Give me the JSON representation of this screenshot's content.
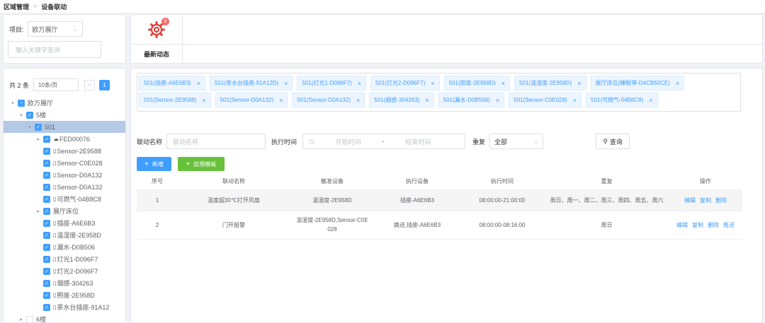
{
  "breadcrumb": {
    "root": "区域管理",
    "separator": ">",
    "current": "设备联动"
  },
  "project": {
    "label": "项目:",
    "selected": "欧万展厅",
    "search_placeholder": "输入关键字查询"
  },
  "dynamics": {
    "badge_count": "0",
    "label": "最新动态"
  },
  "tree_panel": {
    "total": "共 2 条",
    "page_size": "10条/页",
    "current_page": "1",
    "nodes": [
      {
        "label": "欧万展厅",
        "icon": "",
        "level": 0,
        "caret": "▾",
        "check": "indet",
        "selected": false
      },
      {
        "label": "5楼",
        "icon": "",
        "level": 1,
        "caret": "▾",
        "check": "checked",
        "selected": false
      },
      {
        "label": "501",
        "icon": "",
        "level": 2,
        "caret": "▾",
        "check": "checked",
        "selected": true
      },
      {
        "label": "FED00076",
        "icon": "☁",
        "level": 3,
        "caret": "▸",
        "check": "checked",
        "selected": false
      },
      {
        "label": "Sensor-2E9588",
        "icon": "▯",
        "level": 3,
        "caret": "",
        "check": "checked",
        "selected": false
      },
      {
        "label": "Sensor-C0E028",
        "icon": "▯",
        "level": 3,
        "caret": "",
        "check": "checked",
        "selected": false
      },
      {
        "label": "Sensor-D0A132",
        "icon": "▯",
        "level": 3,
        "caret": "",
        "check": "checked",
        "selected": false
      },
      {
        "label": "Sensor-D0A132",
        "icon": "▯",
        "level": 3,
        "caret": "",
        "check": "checked",
        "selected": false
      },
      {
        "label": "可燃气-04B8C8",
        "icon": "▯",
        "level": 3,
        "caret": "",
        "check": "checked",
        "selected": false
      },
      {
        "label": "展厅床位",
        "icon": "",
        "level": 3,
        "caret": "▸",
        "check": "checked",
        "selected": false
      },
      {
        "label": "插座-A6E6B3",
        "icon": "▯",
        "level": 3,
        "caret": "",
        "check": "checked",
        "selected": false
      },
      {
        "label": "温湿度-2E958D",
        "icon": "▯",
        "level": 3,
        "caret": "",
        "check": "checked",
        "selected": false
      },
      {
        "label": "漏水-D0B506",
        "icon": "▯",
        "level": 3,
        "caret": "",
        "check": "checked",
        "selected": false
      },
      {
        "label": "灯光1-D096F7",
        "icon": "▯",
        "level": 3,
        "caret": "",
        "check": "checked",
        "selected": false
      },
      {
        "label": "灯光2-D096F7",
        "icon": "▯",
        "level": 3,
        "caret": "",
        "check": "checked",
        "selected": false
      },
      {
        "label": "烟感-304263",
        "icon": "▯",
        "level": 3,
        "caret": "",
        "check": "checked",
        "selected": false
      },
      {
        "label": "照度-2E958D",
        "icon": "▯",
        "level": 3,
        "caret": "",
        "check": "checked",
        "selected": false
      },
      {
        "label": "茶水台插座-91A12",
        "icon": "▯",
        "level": 3,
        "caret": "",
        "check": "checked",
        "selected": false
      },
      {
        "label": "6楼",
        "icon": "",
        "level": 1,
        "caret": "▸",
        "check": "none",
        "selected": false
      }
    ]
  },
  "tags": [
    "501(插座-A6E6B3)",
    "501(茶水台插座-91A12D)",
    "501(灯光1-D096F7)",
    "501(灯光2-D096F7)",
    "501(照度-2E958D)",
    "501(温湿度-2E958D)",
    "展厅床位(睡眠带-D4CB50CE)",
    "501(Sensor-2E9588)",
    "501(Sensor-D0A132)",
    "501(Sensor-D0A132)",
    "501(烟感-304263)",
    "501(漏水-D0B506)",
    "501(Sensor-C0E028)",
    "501(可燃气-04B8C8)"
  ],
  "filters": {
    "name_label": "联动名称",
    "name_placeholder": "联动名称",
    "time_label": "执行时间",
    "start_placeholder": "开始时间",
    "range_sep": "-",
    "end_placeholder": "结束时间",
    "repeat_label": "重复",
    "repeat_value": "全部",
    "query_button": "查询"
  },
  "actions": {
    "add": "新增",
    "template": "应用模板"
  },
  "table": {
    "headers": [
      "序号",
      "联动名称",
      "触发设备",
      "执行设备",
      "执行时间",
      "重复",
      "操作"
    ],
    "rows": [
      {
        "index": "1",
        "name": "温度超30℃打开风扇",
        "trigger": "温湿度-2E958D",
        "trigger2": "",
        "executor": "插座-A6E6B3",
        "time": "08:00:00-21:00:00",
        "repeat": "周日、周一、周二、周三、周四、周五、周六",
        "ops": [
          "编辑",
          "复制",
          "删除"
        ]
      },
      {
        "index": "2",
        "name": "门开报警",
        "trigger": "温湿度-2E958D,Sensor-C0E",
        "trigger2": "028",
        "executor": "换送,插座-A6E6B3",
        "time": "08:00:00-08:16:00",
        "repeat": "周日",
        "ops": [
          "编辑",
          "复制",
          "删除",
          "推送"
        ]
      }
    ]
  },
  "colors": {
    "primary": "#409eff",
    "success": "#67c23a",
    "danger": "#f56c6c",
    "tree_selected": "#b3c9e6",
    "gear": "#e0403c"
  }
}
